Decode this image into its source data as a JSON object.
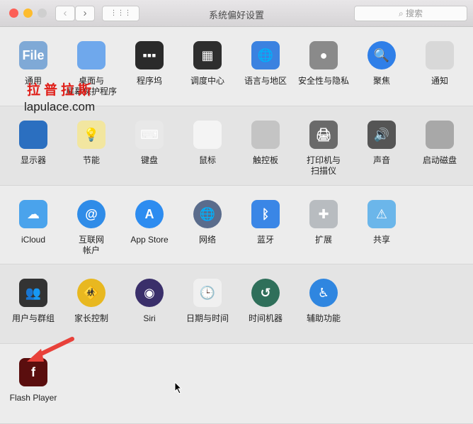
{
  "window": {
    "title": "系统偏好设置",
    "search_placeholder": "搜索",
    "back": "‹",
    "forward": "›",
    "grid": "⋮⋮⋮"
  },
  "rows": [
    [
      {
        "label": "通用",
        "icon": "general-icon",
        "color": "#7fa9d6",
        "glyph": "File"
      },
      {
        "label": "桌面与\n屏幕保护程序",
        "icon": "desktop-screensaver-icon",
        "color": "#6fa8ec",
        "glyph": ""
      },
      {
        "label": "程序坞",
        "icon": "dock-icon",
        "color": "#2a2a2a",
        "glyph": "▪▪▪"
      },
      {
        "label": "调度中心",
        "icon": "mission-control-icon",
        "color": "#2e2e2e",
        "glyph": "▦"
      },
      {
        "label": "语言与地区",
        "icon": "language-region-icon",
        "color": "#3b82e0",
        "glyph": "🌐"
      },
      {
        "label": "安全性与隐私",
        "icon": "security-privacy-icon",
        "color": "#8a8a8a",
        "glyph": "●"
      },
      {
        "label": "聚焦",
        "icon": "spotlight-icon",
        "color": "#2f7fe8",
        "glyph": "🔍"
      },
      {
        "label": "通知",
        "icon": "notifications-icon",
        "color": "#d8d8d8",
        "glyph": ""
      }
    ],
    [
      {
        "label": "显示器",
        "icon": "displays-icon",
        "color": "#2b6fc0",
        "glyph": ""
      },
      {
        "label": "节能",
        "icon": "energy-saver-icon",
        "color": "#f2e6a0",
        "glyph": "💡"
      },
      {
        "label": "键盘",
        "icon": "keyboard-icon",
        "color": "#e8e8e8",
        "glyph": "⌨"
      },
      {
        "label": "鼠标",
        "icon": "mouse-icon",
        "color": "#f4f4f4",
        "glyph": ""
      },
      {
        "label": "触控板",
        "icon": "trackpad-icon",
        "color": "#c4c4c4",
        "glyph": ""
      },
      {
        "label": "打印机与\n扫描仪",
        "icon": "printer-scanner-icon",
        "color": "#6a6a6a",
        "glyph": "🖨"
      },
      {
        "label": "声音",
        "icon": "sound-icon",
        "color": "#555",
        "glyph": "🔊"
      },
      {
        "label": "启动磁盘",
        "icon": "startup-disk-icon",
        "color": "#a8a8a8",
        "glyph": ""
      }
    ],
    [
      {
        "label": "iCloud",
        "icon": "icloud-icon",
        "color": "#4aa3ec",
        "glyph": "☁"
      },
      {
        "label": "互联网\n帐户",
        "icon": "internet-accounts-icon",
        "color": "#2f8ce8",
        "glyph": "@"
      },
      {
        "label": "App Store",
        "icon": "app-store-icon",
        "color": "#2d8cf0",
        "glyph": "A"
      },
      {
        "label": "网络",
        "icon": "network-icon",
        "color": "#5a6c8c",
        "glyph": "🌐"
      },
      {
        "label": "蓝牙",
        "icon": "bluetooth-icon",
        "color": "#3a86e6",
        "glyph": "ᛒ"
      },
      {
        "label": "扩展",
        "icon": "extensions-icon",
        "color": "#b8bcc0",
        "glyph": "✚"
      },
      {
        "label": "共享",
        "icon": "sharing-icon",
        "color": "#6bb6ea",
        "glyph": "⚠"
      }
    ],
    [
      {
        "label": "用户与群组",
        "icon": "users-groups-icon",
        "color": "#333",
        "glyph": "👥"
      },
      {
        "label": "家长控制",
        "icon": "parental-controls-icon",
        "color": "#e8b820",
        "glyph": "🚸"
      },
      {
        "label": "Siri",
        "icon": "siri-icon",
        "color": "#3a2f6a",
        "glyph": "◉"
      },
      {
        "label": "日期与时间",
        "icon": "date-time-icon",
        "color": "#f0f0f0",
        "glyph": "🕒"
      },
      {
        "label": "时间机器",
        "icon": "time-machine-icon",
        "color": "#2f6f5a",
        "glyph": "↺"
      },
      {
        "label": "辅助功能",
        "icon": "accessibility-icon",
        "color": "#2f86e0",
        "glyph": "♿"
      }
    ],
    [
      {
        "label": "Flash Player",
        "icon": "flash-player-icon",
        "color": "#5a0e0e",
        "glyph": "f"
      }
    ]
  ],
  "watermark": {
    "chinese": "拉普拉斯",
    "site": "lapulace.com"
  }
}
